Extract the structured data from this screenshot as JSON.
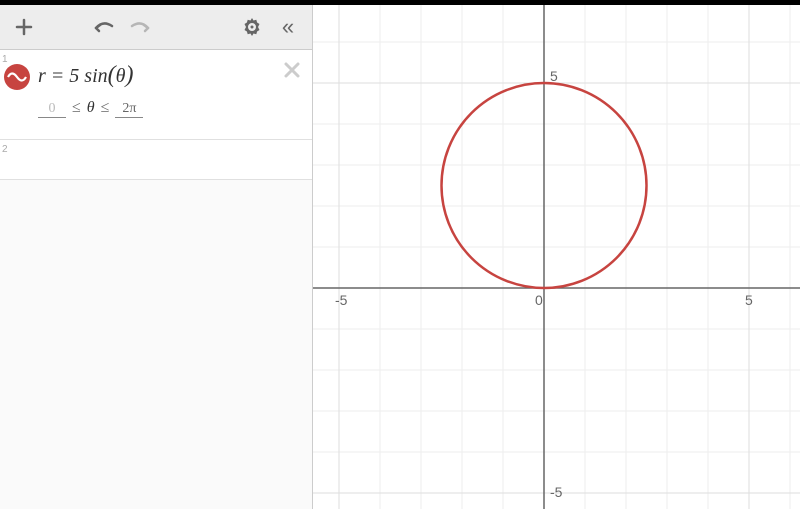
{
  "toolbar": {
    "add_label": "+",
    "undo_label": "undo",
    "redo_label": "redo",
    "settings_label": "settings",
    "collapse_label": "«"
  },
  "expressions": [
    {
      "index": "1",
      "equation": "r = 5 sin(θ)",
      "domain_min": "0",
      "domain_op1": "≤",
      "domain_var": "θ",
      "domain_op2": "≤",
      "domain_max": "2π",
      "color": "#c74440"
    },
    {
      "index": "2"
    }
  ],
  "graph": {
    "x_ticks": [
      -5,
      0,
      5
    ],
    "y_ticks": [
      -5,
      5
    ],
    "x_range": [
      -7,
      7
    ],
    "y_range": [
      -7,
      7
    ]
  },
  "chart_data": {
    "type": "polar",
    "equation": "r = 5*sin(theta)",
    "theta_range": [
      0,
      6.283185307
    ],
    "cartesian_equivalent": "circle center (0, 2.5) radius 2.5",
    "color": "#c74440"
  }
}
